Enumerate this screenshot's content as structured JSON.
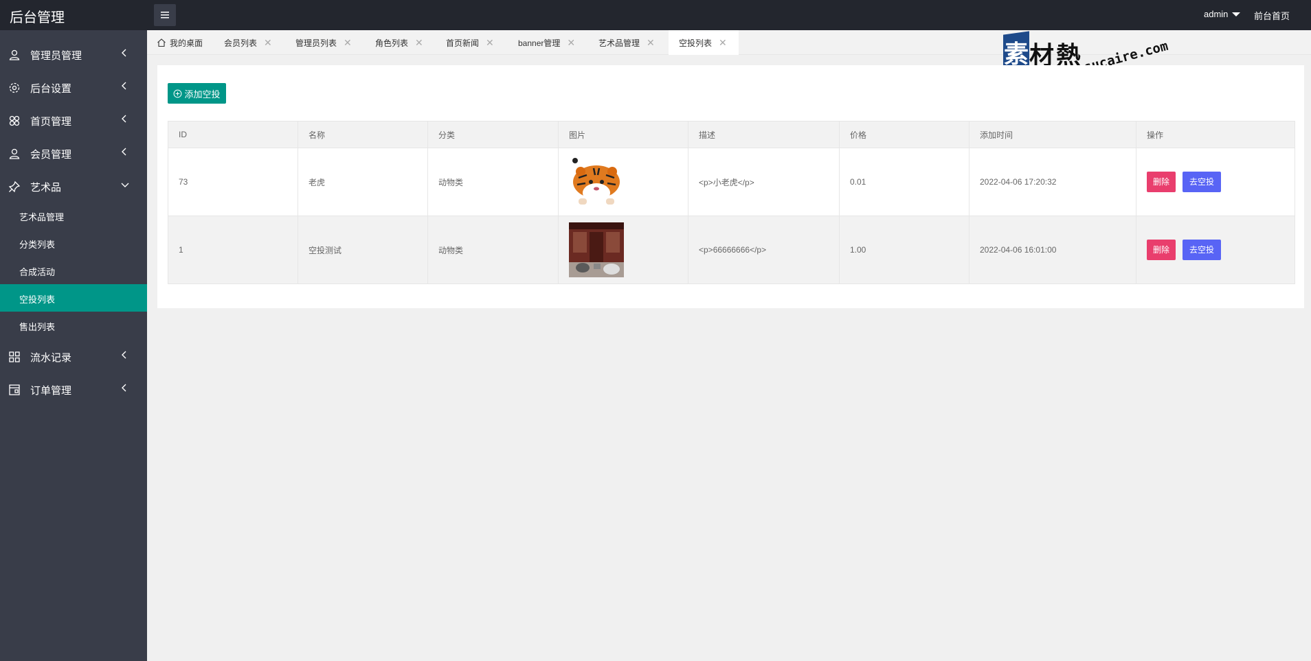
{
  "header": {
    "title": "后台管理",
    "user": "admin",
    "front_link": "前台首页"
  },
  "sidebar": {
    "items": [
      {
        "label": "管理员管理",
        "icon": "user-icon"
      },
      {
        "label": "后台设置",
        "icon": "gear-icon"
      },
      {
        "label": "首页管理",
        "icon": "flower-icon"
      },
      {
        "label": "会员管理",
        "icon": "user-icon"
      },
      {
        "label": "艺术品",
        "icon": "pin-icon"
      },
      {
        "label": "流水记录",
        "icon": "grid-icon"
      },
      {
        "label": "订单管理",
        "icon": "form-icon"
      }
    ],
    "sub_items": [
      {
        "label": "艺术品管理"
      },
      {
        "label": "分类列表"
      },
      {
        "label": "合成活动"
      },
      {
        "label": "空投列表",
        "active": true
      },
      {
        "label": "售出列表"
      }
    ]
  },
  "tabs": [
    {
      "label": "我的桌面"
    },
    {
      "label": "会员列表"
    },
    {
      "label": "管理员列表"
    },
    {
      "label": "角色列表"
    },
    {
      "label": "首页新闻"
    },
    {
      "label": "banner管理"
    },
    {
      "label": "艺术品管理"
    },
    {
      "label": "空投列表",
      "active": true
    }
  ],
  "watermark": {
    "chars": [
      "素",
      "材",
      "熱"
    ],
    "url": "sucaire.com"
  },
  "toolbar": {
    "add_label": "添加空投"
  },
  "table": {
    "columns": [
      "ID",
      "名称",
      "分类",
      "图片",
      "描述",
      "价格",
      "添加时间",
      "操作"
    ],
    "rows": [
      {
        "id": "73",
        "name": "老虎",
        "category": "动物类",
        "image": "tiger-thumbnail",
        "desc": "<p>小老虎</p>",
        "price": "0.01",
        "time": "2022-04-06 17:20:32"
      },
      {
        "id": "1",
        "name": "空投测试",
        "category": "动物类",
        "image": "shop-front-thumbnail",
        "desc": "<p>66666666</p>",
        "price": "1.00",
        "time": "2022-04-06 16:01:00"
      }
    ],
    "delete_label": "删除",
    "airdrop_label": "去空投"
  },
  "colors": {
    "topbar": "#23262e",
    "sidebar": "#393d49",
    "accent": "#009688",
    "delete": "#e93e6d",
    "airdrop": "#5864f5"
  }
}
